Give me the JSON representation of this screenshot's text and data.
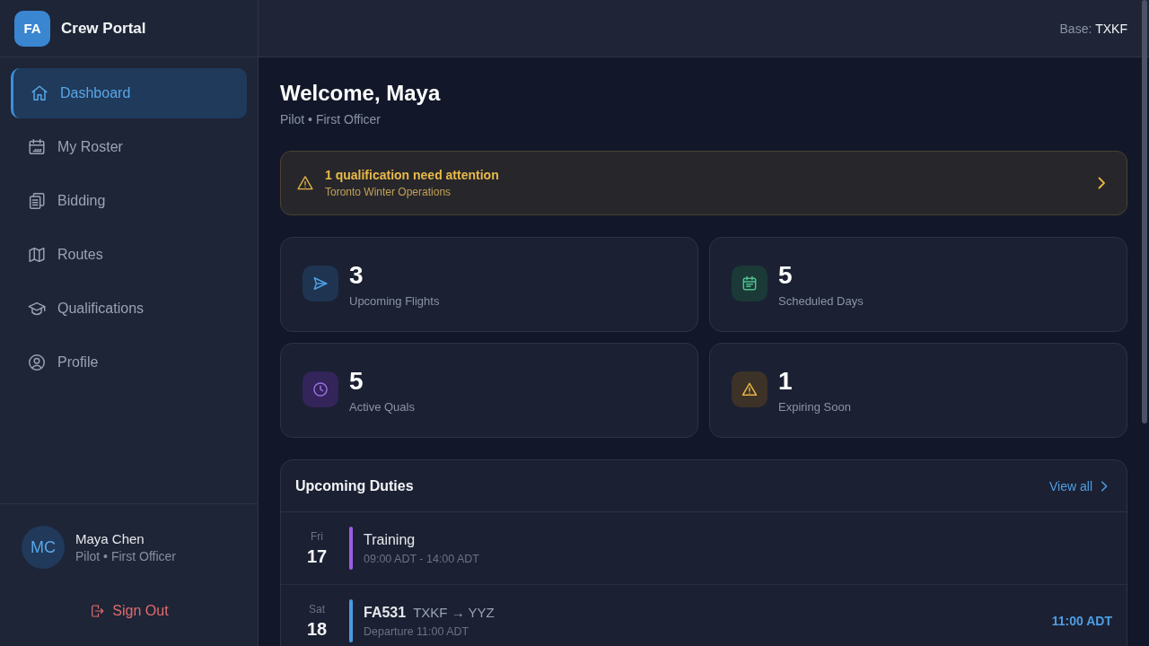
{
  "sidebar": {
    "logo": "FA",
    "app_name": "Crew Portal",
    "items": [
      {
        "label": "Dashboard",
        "selected": true
      },
      {
        "label": "My Roster",
        "selected": false
      },
      {
        "label": "Bidding",
        "selected": false
      },
      {
        "label": "Routes",
        "selected": false
      },
      {
        "label": "Qualifications",
        "selected": false
      },
      {
        "label": "Profile",
        "selected": false
      }
    ],
    "user": {
      "initials": "MC",
      "name": "Maya Chen",
      "role": "Pilot • First Officer"
    },
    "sign_out": "Sign Out"
  },
  "top_bar": {
    "base_label": "Base:",
    "base_value": "TXKF"
  },
  "welcome": {
    "title": "Welcome, Maya",
    "subtitle": "Pilot • First Officer"
  },
  "alert": {
    "title": "1 qualification need attention",
    "subtitle": "Toronto Winter Operations"
  },
  "stats": [
    {
      "value": "3",
      "label": "Upcoming Flights"
    },
    {
      "value": "5",
      "label": "Scheduled Days"
    },
    {
      "value": "5",
      "label": "Active Quals"
    },
    {
      "value": "1",
      "label": "Expiring Soon"
    }
  ],
  "duties": {
    "title": "Upcoming Duties",
    "view_all": "View all",
    "rows": [
      {
        "kind": "training",
        "day": "Fri",
        "date": "17",
        "title": "Training",
        "detail": "09:00 ADT - 14:00 ADT",
        "color": "#9b5de5"
      },
      {
        "kind": "flight",
        "day": "Sat",
        "date": "18",
        "title": "FA531",
        "route": "TXKF → YYZ",
        "detail": "Departure 11:00 ADT",
        "time": "11:00 ADT",
        "color": "#4a9be0"
      }
    ]
  }
}
